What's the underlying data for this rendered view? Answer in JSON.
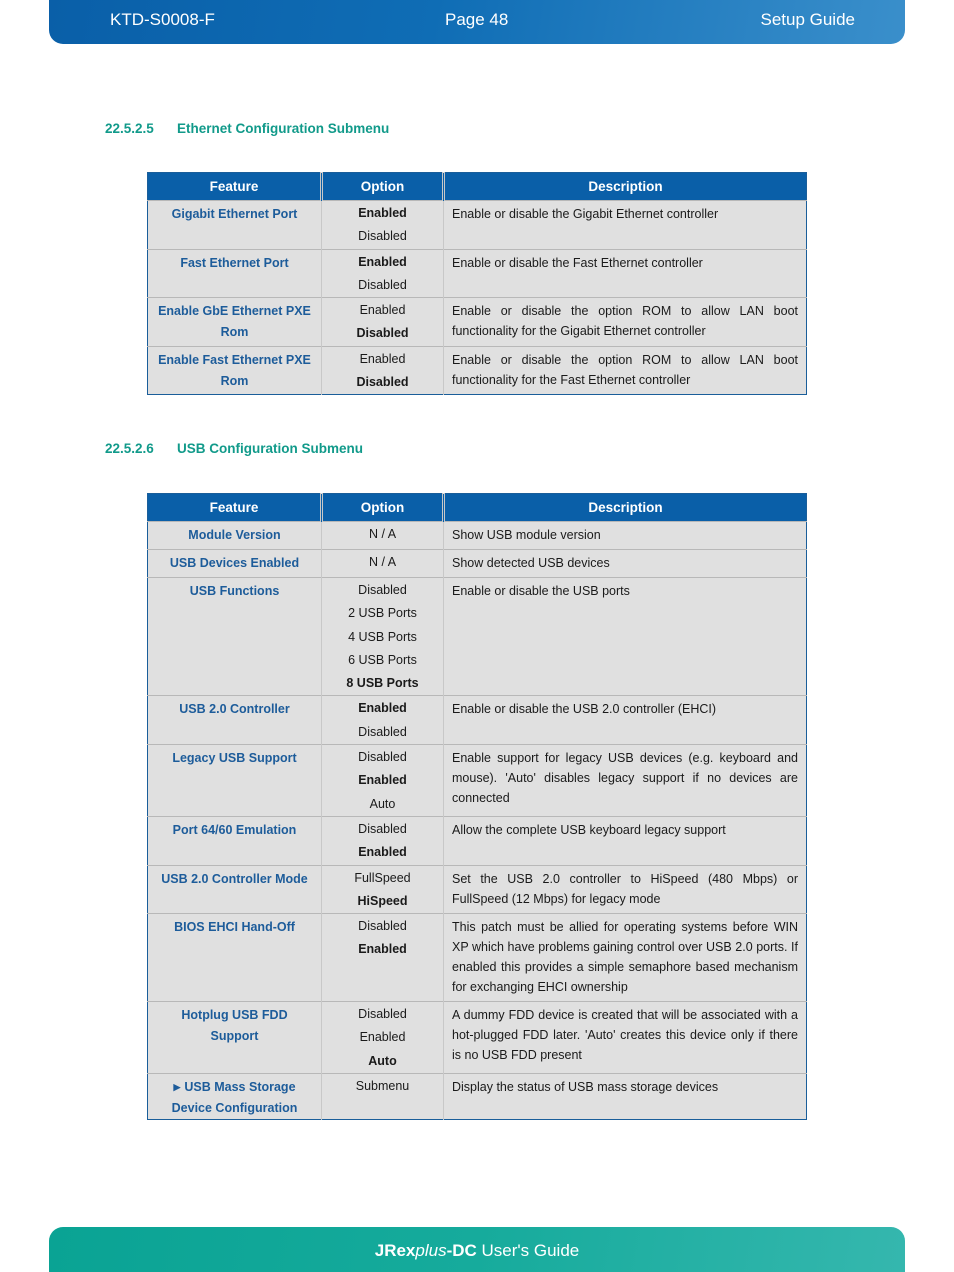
{
  "header": {
    "doc_id": "KTD-S0008-F",
    "page": "Page 48",
    "section": "Setup Guide"
  },
  "ethernet": {
    "number": "22.5.2.5",
    "title": "Ethernet Configuration Submenu",
    "columns": [
      "Feature",
      "Option",
      "Description"
    ],
    "rows": [
      {
        "feature": "Gigabit Ethernet Port",
        "options": [
          {
            "label": "Enabled",
            "selected": true
          },
          {
            "label": "Disabled",
            "selected": false
          }
        ],
        "description": "Enable or disable the Gigabit Ethernet controller"
      },
      {
        "feature": "Fast Ethernet Port",
        "options": [
          {
            "label": "Enabled",
            "selected": true
          },
          {
            "label": "Disabled",
            "selected": false
          }
        ],
        "description": "Enable or disable the Fast Ethernet controller"
      },
      {
        "feature": "Enable GbE Ethernet PXE Rom",
        "options": [
          {
            "label": "Enabled",
            "selected": false
          },
          {
            "label": "Disabled",
            "selected": true
          }
        ],
        "description": "Enable or disable the option ROM to allow LAN boot functionality for the Gigabit Ethernet controller"
      },
      {
        "feature": "Enable Fast Ethernet PXE Rom",
        "options": [
          {
            "label": "Enabled",
            "selected": false
          },
          {
            "label": "Disabled",
            "selected": true
          }
        ],
        "description": "Enable or disable the option ROM to allow LAN boot functionality for the Fast Ethernet controller"
      }
    ]
  },
  "usb": {
    "number": "22.5.2.6",
    "title": "USB Configuration Submenu",
    "columns": [
      "Feature",
      "Option",
      "Description"
    ],
    "rows": [
      {
        "feature": "Module Version",
        "options": [
          {
            "label": "N / A",
            "selected": false
          }
        ],
        "description": "Show USB module version"
      },
      {
        "feature": "USB Devices Enabled",
        "options": [
          {
            "label": "N / A",
            "selected": false
          }
        ],
        "description": "Show detected USB devices"
      },
      {
        "feature": "USB Functions",
        "options": [
          {
            "label": "Disabled",
            "selected": false
          },
          {
            "label": "2 USB Ports",
            "selected": false
          },
          {
            "label": "4 USB Ports",
            "selected": false
          },
          {
            "label": "6 USB Ports",
            "selected": false
          },
          {
            "label": "8 USB Ports",
            "selected": true
          }
        ],
        "description": "Enable or disable the USB ports"
      },
      {
        "feature": "USB 2.0 Controller",
        "options": [
          {
            "label": "Enabled",
            "selected": true
          },
          {
            "label": "Disabled",
            "selected": false
          }
        ],
        "description": "Enable or disable the USB 2.0 controller (EHCI)"
      },
      {
        "feature": "Legacy USB Support",
        "options": [
          {
            "label": "Disabled",
            "selected": false
          },
          {
            "label": "Enabled",
            "selected": true
          },
          {
            "label": "Auto",
            "selected": false
          }
        ],
        "description": "Enable support for legacy USB devices (e.g. keyboard and mouse). 'Auto' disables legacy support if no devices are connected"
      },
      {
        "feature": "Port 64/60 Emulation",
        "options": [
          {
            "label": "Disabled",
            "selected": false
          },
          {
            "label": "Enabled",
            "selected": true
          }
        ],
        "description": "Allow the complete USB keyboard legacy support"
      },
      {
        "feature": "USB 2.0 Controller Mode",
        "options": [
          {
            "label": "FullSpeed",
            "selected": false
          },
          {
            "label": "HiSpeed",
            "selected": true
          }
        ],
        "description": "Set the USB 2.0 controller to HiSpeed (480 Mbps) or FullSpeed (12 Mbps) for legacy mode"
      },
      {
        "feature": "BIOS EHCI Hand-Off",
        "options": [
          {
            "label": "Disabled",
            "selected": false
          },
          {
            "label": "Enabled",
            "selected": true
          }
        ],
        "description": "This patch must be allied for operating systems before WIN XP which have problems gaining control over USB 2.0 ports. If enabled this provides a simple semaphore based mechanism for exchanging EHCI ownership"
      },
      {
        "feature": "Hotplug USB FDD Support",
        "options": [
          {
            "label": "Disabled",
            "selected": false
          },
          {
            "label": "Enabled",
            "selected": false
          },
          {
            "label": "Auto",
            "selected": true
          }
        ],
        "description": "A dummy FDD device is created that will be associated with a hot-plugged FDD later. 'Auto' creates this device only if there is no USB FDD present"
      },
      {
        "feature": "USB Mass Storage Device Configuration",
        "submenu_icon": "triangle-right-icon",
        "options": [
          {
            "label": "Submenu",
            "selected": false
          }
        ],
        "description": "Display the status of USB mass storage devices"
      }
    ]
  },
  "footer": {
    "product_bold": "JRex",
    "product_italic": "plus",
    "product_suffix": "-DC",
    "guide": " User's Guide"
  },
  "colors": {
    "header_blue": "#0a5fa8",
    "section_teal": "#119a8a",
    "feature_blue": "#1d5c9a",
    "footer_teal": "#16ab9c",
    "cell_gray": "#e0e0e0"
  }
}
